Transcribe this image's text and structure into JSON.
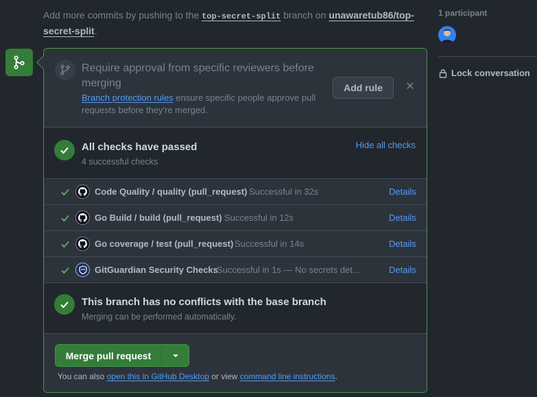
{
  "intro": {
    "prefix": "Add more commits by pushing to the ",
    "branch": "top-secret-split",
    "middle": " branch on ",
    "repo": "unawaretub86/top-secret-split",
    "suffix": "."
  },
  "review": {
    "title": "Require approval from specific reviewers before merging",
    "link": "Branch protection rules",
    "desc": " ensure specific people approve pull requests before they're merged.",
    "add_rule": "Add rule",
    "close": "✕"
  },
  "checks": {
    "title": "All checks have passed",
    "subtitle": "4 successful checks",
    "hide": "Hide all checks",
    "items": [
      {
        "name": "Code Quality / quality (pull_request)",
        "status": "Successful in 32s",
        "details": "Details"
      },
      {
        "name": "Go Build / build (pull_request)",
        "status": "Successful in 12s",
        "details": "Details"
      },
      {
        "name": "Go coverage / test (pull_request)",
        "status": "Successful in 14s",
        "details": "Details"
      },
      {
        "name": "GitGuardian Security Checks",
        "status": "Successful in 1s — No secrets det...",
        "details": "Details"
      }
    ]
  },
  "conflicts": {
    "title": "This branch has no conflicts with the base branch",
    "subtitle": "Merging can be performed automatically."
  },
  "merge": {
    "button": "Merge pull request",
    "note_prefix": "You can also ",
    "desktop_link": "open this in GitHub Desktop",
    "note_middle": " or view ",
    "cli_link": "command line instructions",
    "note_suffix": "."
  },
  "sidebar": {
    "participants": "1 participant",
    "lock": "Lock conversation"
  },
  "colors": {
    "success": "#347d39",
    "link": "#539bf5",
    "border_success": "#46954a"
  }
}
